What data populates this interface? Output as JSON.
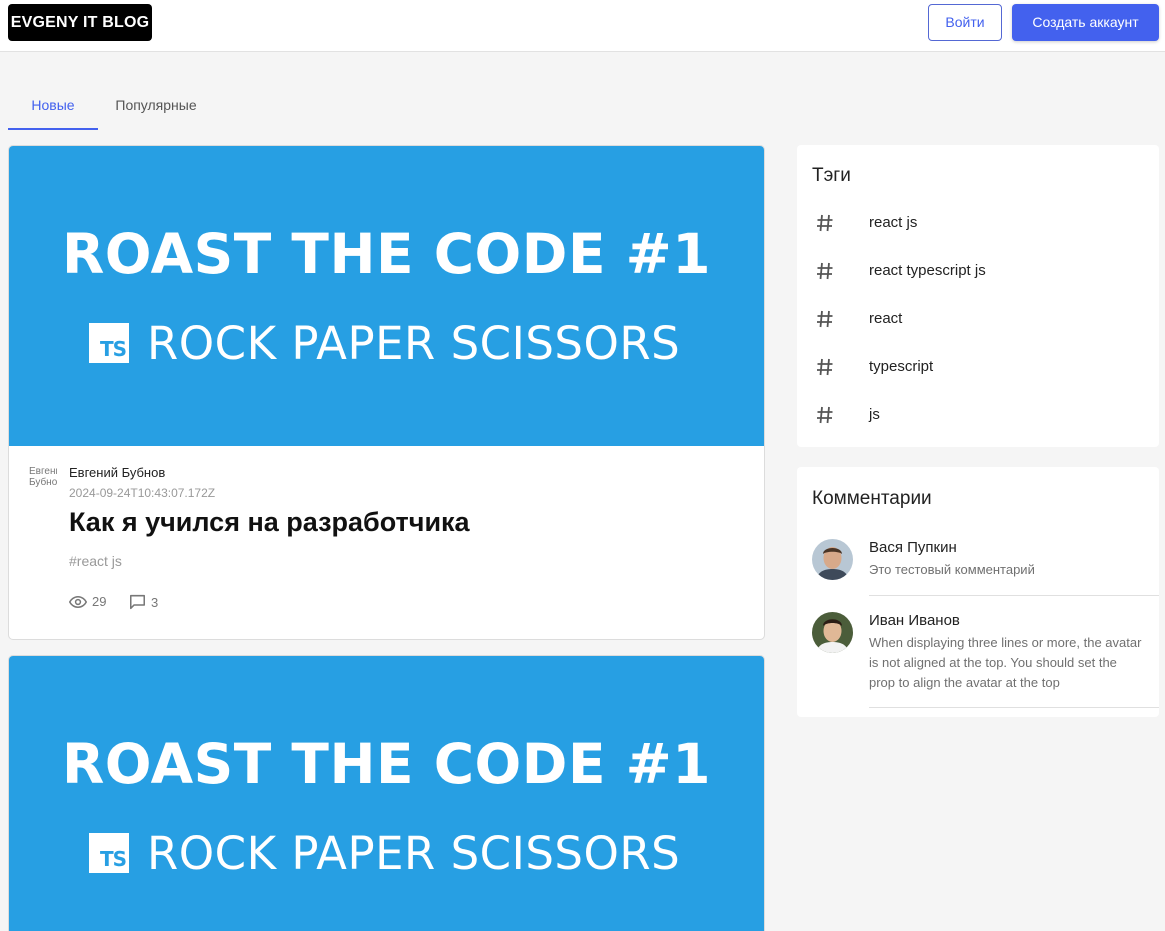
{
  "header": {
    "logo": "EVGENY IT BLOG",
    "login_label": "Войти",
    "register_label": "Создать аккаунт"
  },
  "tabs": [
    {
      "label": "Новые",
      "active": true
    },
    {
      "label": "Популярные",
      "active": false
    }
  ],
  "posts": [
    {
      "banner_title": "ROAST THE CODE #1",
      "banner_badge": "TS",
      "banner_subtitle": "ROCK PAPER SCISSORS",
      "avatar_alt": "Евгений Бубнов",
      "author": "Евгений Бубнов",
      "date": "2024-09-24T10:43:07.172Z",
      "title": "Как я учился на разработчика",
      "tag": "#react js",
      "views": "29",
      "comments": "3"
    },
    {
      "banner_title": "ROAST THE CODE #1",
      "banner_badge": "TS",
      "banner_subtitle": "ROCK PAPER SCISSORS"
    }
  ],
  "sidebar": {
    "tags_title": "Тэги",
    "tags": [
      "react js",
      "react typescript js",
      "react",
      "typescript",
      "js"
    ],
    "comments_title": "Комментарии",
    "comments": [
      {
        "name": "Вася Пупкин",
        "text": "Это тестовый комментарий"
      },
      {
        "name": "Иван Иванов",
        "text": "When displaying three lines or more, the avatar is not aligned at the top. You should set the prop to align the avatar at the top"
      }
    ]
  },
  "colors": {
    "accent": "#4361ee",
    "banner": "#279fe3"
  }
}
